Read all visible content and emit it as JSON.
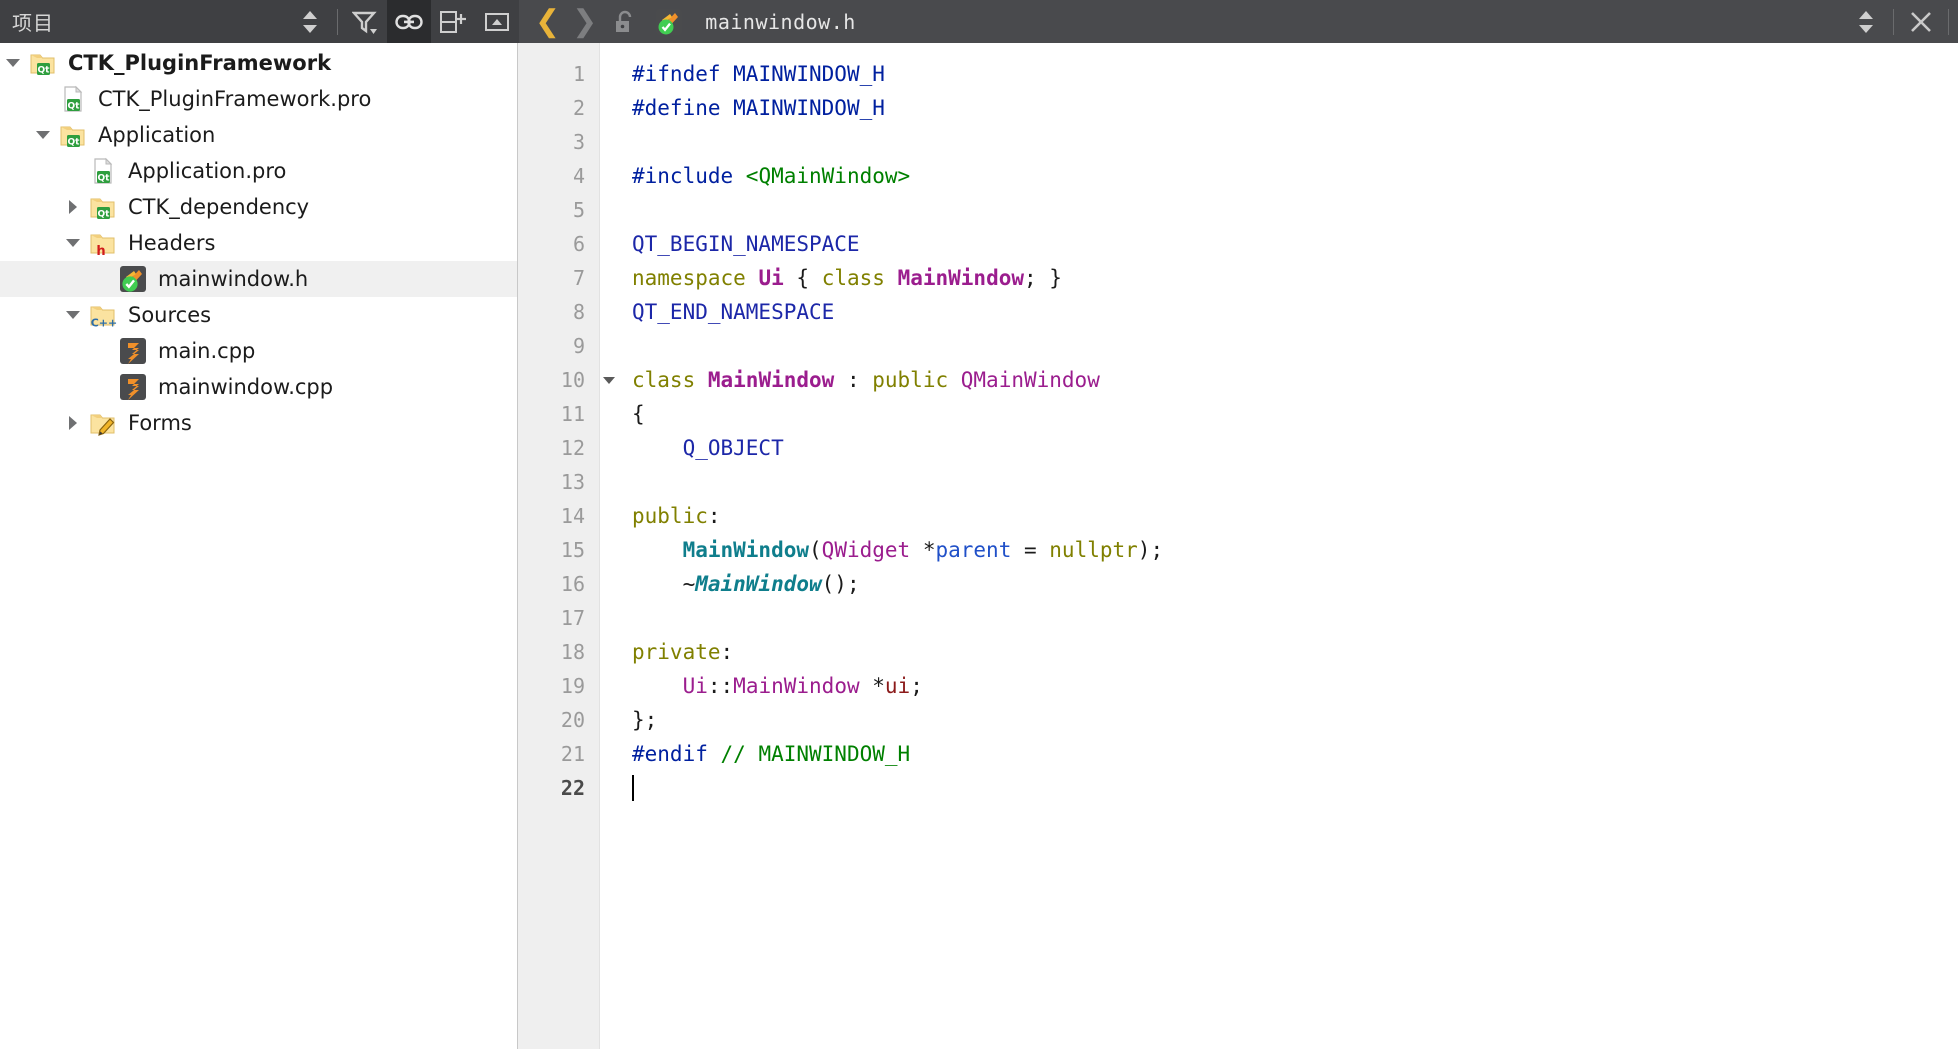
{
  "window": {
    "sidebar_title": "项目",
    "filename": "mainwindow.h"
  },
  "sidebar_toolbar": {
    "sync_label": "",
    "filter_label": "",
    "link_label": "",
    "split_label": "",
    "close_label": ""
  },
  "editor_toolbar": {
    "back_label": "❮",
    "forward_label": "❯",
    "lock_label": "",
    "splitter_label": "",
    "close_label": "✕"
  },
  "tree": {
    "items": [
      {
        "label": "CTK_PluginFramework",
        "indent": 0,
        "twisty": "open",
        "icon": "folder-qt-icon",
        "bold": true,
        "selected": false
      },
      {
        "label": "CTK_PluginFramework.pro",
        "indent": 1,
        "twisty": "none",
        "icon": "file-qt-icon",
        "bold": false,
        "selected": false
      },
      {
        "label": "Application",
        "indent": 1,
        "twisty": "open",
        "icon": "folder-qt-icon",
        "bold": false,
        "selected": false
      },
      {
        "label": "Application.pro",
        "indent": 2,
        "twisty": "none",
        "icon": "file-qt-icon",
        "bold": false,
        "selected": false
      },
      {
        "label": "CTK_dependency",
        "indent": 2,
        "twisty": "closed",
        "icon": "folder-qt-icon",
        "bold": false,
        "selected": false
      },
      {
        "label": "Headers",
        "indent": 2,
        "twisty": "open",
        "icon": "folder-h-icon",
        "bold": false,
        "selected": false
      },
      {
        "label": "mainwindow.h",
        "indent": 3,
        "twisty": "none",
        "icon": "qt-header-file-icon",
        "bold": false,
        "selected": true
      },
      {
        "label": "Sources",
        "indent": 2,
        "twisty": "open",
        "icon": "folder-cpp-icon",
        "bold": false,
        "selected": false
      },
      {
        "label": "main.cpp",
        "indent": 3,
        "twisty": "none",
        "icon": "cpp-file-icon",
        "bold": false,
        "selected": false
      },
      {
        "label": "mainwindow.cpp",
        "indent": 3,
        "twisty": "none",
        "icon": "cpp-file-icon",
        "bold": false,
        "selected": false
      },
      {
        "label": "Forms",
        "indent": 2,
        "twisty": "closed",
        "icon": "folder-forms-icon",
        "bold": false,
        "selected": false
      }
    ]
  },
  "code": {
    "current_line": 22,
    "lines": [
      {
        "n": 1,
        "fold": false,
        "tokens": [
          {
            "t": "#ifndef ",
            "c": "t-pre"
          },
          {
            "t": "MAINWINDOW_H",
            "c": "t-pre"
          }
        ]
      },
      {
        "n": 2,
        "fold": false,
        "tokens": [
          {
            "t": "#define ",
            "c": "t-pre"
          },
          {
            "t": "MAINWINDOW_H",
            "c": "t-pre"
          }
        ]
      },
      {
        "n": 3,
        "fold": false,
        "tokens": []
      },
      {
        "n": 4,
        "fold": false,
        "tokens": [
          {
            "t": "#include ",
            "c": "t-pre"
          },
          {
            "t": "<QMainWindow>",
            "c": "t-str"
          }
        ]
      },
      {
        "n": 5,
        "fold": false,
        "tokens": []
      },
      {
        "n": 6,
        "fold": false,
        "tokens": [
          {
            "t": "QT_BEGIN_NAMESPACE",
            "c": "t-macro"
          }
        ]
      },
      {
        "n": 7,
        "fold": false,
        "tokens": [
          {
            "t": "namespace",
            "c": "t-kw"
          },
          {
            "t": " ",
            "c": "t-plain"
          },
          {
            "t": "Ui",
            "c": "t-type"
          },
          {
            "t": " { ",
            "c": "t-plain"
          },
          {
            "t": "class",
            "c": "t-kw"
          },
          {
            "t": " ",
            "c": "t-plain"
          },
          {
            "t": "MainWindow",
            "c": "t-type"
          },
          {
            "t": "; }",
            "c": "t-plain"
          }
        ]
      },
      {
        "n": 8,
        "fold": false,
        "tokens": [
          {
            "t": "QT_END_NAMESPACE",
            "c": "t-macro"
          }
        ]
      },
      {
        "n": 9,
        "fold": false,
        "tokens": []
      },
      {
        "n": 10,
        "fold": true,
        "tokens": [
          {
            "t": "class",
            "c": "t-kw"
          },
          {
            "t": " ",
            "c": "t-plain"
          },
          {
            "t": "MainWindow",
            "c": "t-type"
          },
          {
            "t": " : ",
            "c": "t-plain"
          },
          {
            "t": "public",
            "c": "t-kw"
          },
          {
            "t": " ",
            "c": "t-plain"
          },
          {
            "t": "QMainWindow",
            "c": "t-type2"
          }
        ]
      },
      {
        "n": 11,
        "fold": false,
        "tokens": [
          {
            "t": "{",
            "c": "t-plain"
          }
        ]
      },
      {
        "n": 12,
        "fold": false,
        "tokens": [
          {
            "t": "    ",
            "c": "t-plain"
          },
          {
            "t": "Q_OBJECT",
            "c": "t-macro"
          }
        ]
      },
      {
        "n": 13,
        "fold": false,
        "tokens": []
      },
      {
        "n": 14,
        "fold": false,
        "tokens": [
          {
            "t": "public",
            "c": "t-kw"
          },
          {
            "t": ":",
            "c": "t-plain"
          }
        ]
      },
      {
        "n": 15,
        "fold": false,
        "tokens": [
          {
            "t": "    ",
            "c": "t-plain"
          },
          {
            "t": "MainWindow",
            "c": "t-fn"
          },
          {
            "t": "(",
            "c": "t-plain"
          },
          {
            "t": "QWidget",
            "c": "t-type2"
          },
          {
            "t": " *",
            "c": "t-plain"
          },
          {
            "t": "parent",
            "c": "t-param"
          },
          {
            "t": " = ",
            "c": "t-plain"
          },
          {
            "t": "nullptr",
            "c": "t-kw"
          },
          {
            "t": ");",
            "c": "t-plain"
          }
        ]
      },
      {
        "n": 16,
        "fold": false,
        "tokens": [
          {
            "t": "    ~",
            "c": "t-plain"
          },
          {
            "t": "MainWindow",
            "c": "t-fn-v"
          },
          {
            "t": "();",
            "c": "t-plain"
          }
        ]
      },
      {
        "n": 17,
        "fold": false,
        "tokens": []
      },
      {
        "n": 18,
        "fold": false,
        "tokens": [
          {
            "t": "private",
            "c": "t-kw"
          },
          {
            "t": ":",
            "c": "t-plain"
          }
        ]
      },
      {
        "n": 19,
        "fold": false,
        "tokens": [
          {
            "t": "    ",
            "c": "t-plain"
          },
          {
            "t": "Ui",
            "c": "t-type2"
          },
          {
            "t": "::",
            "c": "t-plain"
          },
          {
            "t": "MainWindow",
            "c": "t-type2"
          },
          {
            "t": " *",
            "c": "t-plain"
          },
          {
            "t": "ui",
            "c": "t-field"
          },
          {
            "t": ";",
            "c": "t-plain"
          }
        ]
      },
      {
        "n": 20,
        "fold": false,
        "tokens": [
          {
            "t": "};",
            "c": "t-plain"
          }
        ]
      },
      {
        "n": 21,
        "fold": false,
        "tokens": [
          {
            "t": "#endif",
            "c": "t-pre"
          },
          {
            "t": " ",
            "c": "t-plain"
          },
          {
            "t": "// MAINWINDOW_H",
            "c": "t-com"
          }
        ]
      },
      {
        "n": 22,
        "fold": false,
        "tokens": [],
        "caret": true
      }
    ]
  },
  "colors": {
    "chrome": "#3f4043",
    "chrome_light": "#494a4d",
    "selection": "#f0f0f0",
    "gutter": "#efefef",
    "accent_yellow": "#e8b339",
    "qt_green": "#41cd52"
  }
}
